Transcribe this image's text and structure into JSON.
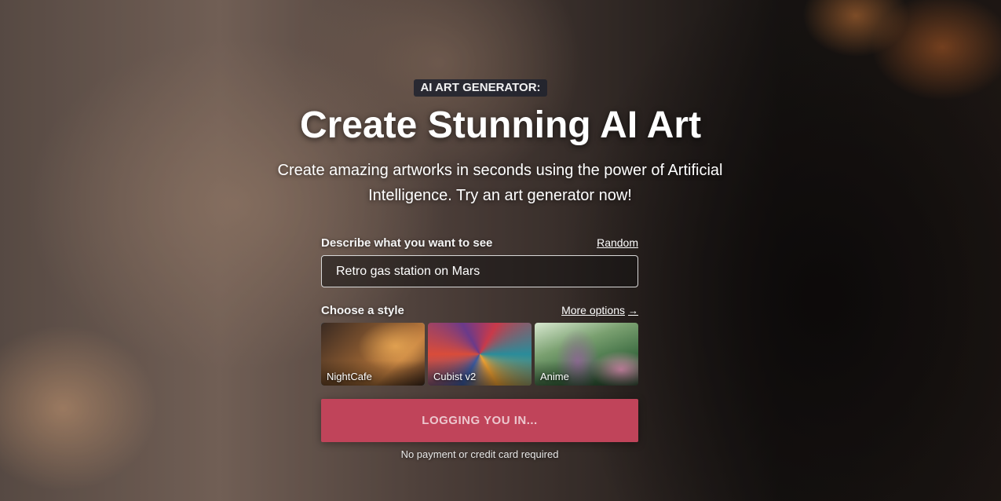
{
  "hero": {
    "eyebrow": "AI ART GENERATOR:",
    "title": "Create Stunning AI Art",
    "subtitle": "Create amazing artworks in seconds using the power of Artificial Intelligence. Try an art generator now!"
  },
  "prompt": {
    "label": "Describe what you want to see",
    "random_link": "Random",
    "value": "Retro gas station on Mars"
  },
  "style": {
    "label": "Choose a style",
    "more_options_link": "More options",
    "more_options_icon": "arrow-right-icon",
    "options": [
      {
        "name": "NightCafe",
        "selected": true
      },
      {
        "name": "Cubist v2",
        "selected": false
      },
      {
        "name": "Anime",
        "selected": false
      }
    ]
  },
  "cta": {
    "label": "LOGGING YOU IN...",
    "color": "#c0445a"
  },
  "note": "No payment or credit card required",
  "colors": {
    "selected_outline": "#1e8fe1"
  }
}
